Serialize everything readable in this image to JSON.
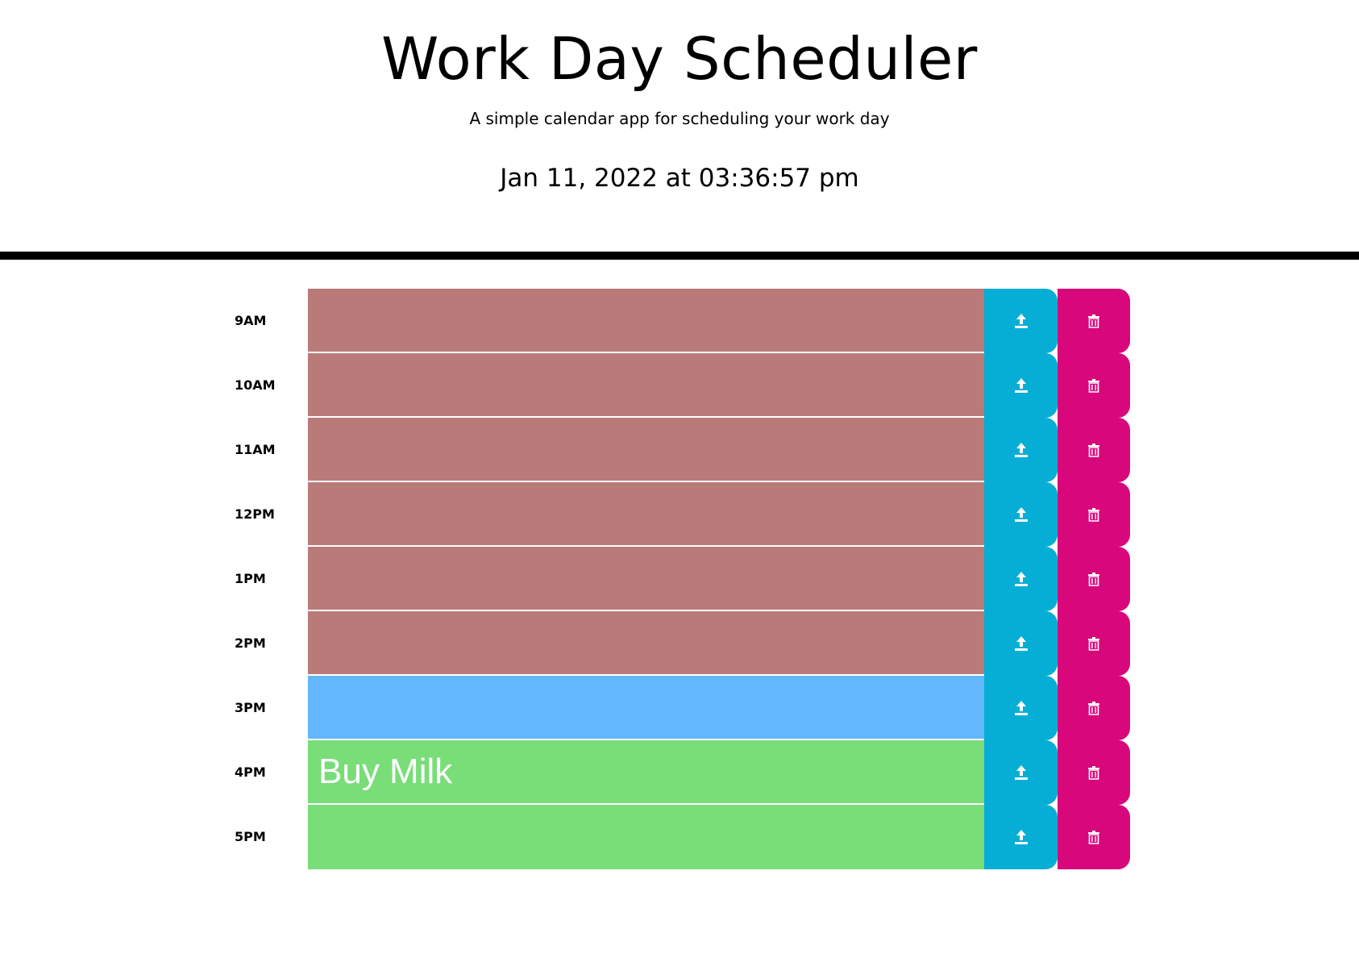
{
  "header": {
    "title": "Work Day Scheduler",
    "subtitle": "A simple calendar app for scheduling your work day",
    "datetime": "Jan 11, 2022 at 03:36:57 pm"
  },
  "colors": {
    "past": "#bb7a7a",
    "present": "#62b7fd",
    "future": "#79dd78",
    "save": "#06aed6",
    "delete": "#d8077b"
  },
  "icons": {
    "save": "upload-icon",
    "delete": "trash-icon"
  },
  "rows": [
    {
      "hour": "9AM",
      "text": "",
      "state": "past"
    },
    {
      "hour": "10AM",
      "text": "",
      "state": "past"
    },
    {
      "hour": "11AM",
      "text": "",
      "state": "past"
    },
    {
      "hour": "12PM",
      "text": "",
      "state": "past"
    },
    {
      "hour": "1PM",
      "text": "",
      "state": "past"
    },
    {
      "hour": "2PM",
      "text": "",
      "state": "past"
    },
    {
      "hour": "3PM",
      "text": "",
      "state": "present"
    },
    {
      "hour": "4PM",
      "text": "Buy Milk",
      "state": "future"
    },
    {
      "hour": "5PM",
      "text": "",
      "state": "future"
    }
  ]
}
